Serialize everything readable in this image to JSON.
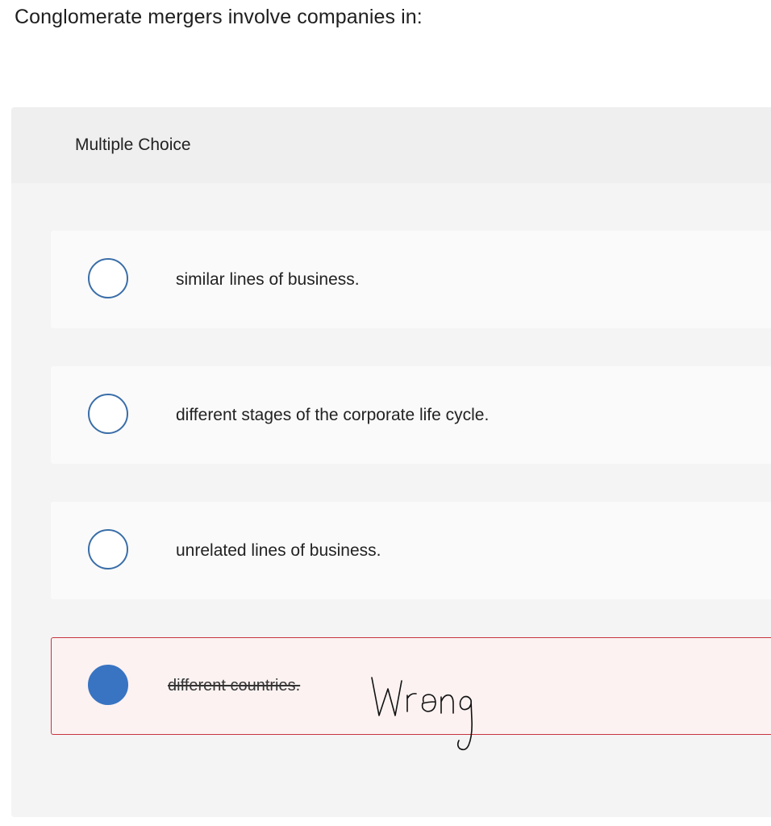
{
  "question": {
    "text": "Conglomerate mergers involve companies in:"
  },
  "panel": {
    "header_label": "Multiple Choice"
  },
  "options": [
    {
      "label": "similar lines of business.",
      "selected": false
    },
    {
      "label": "different stages of the corporate life cycle.",
      "selected": false
    },
    {
      "label": "unrelated lines of business.",
      "selected": false
    },
    {
      "label": "different countries.",
      "selected": true
    }
  ],
  "annotation": {
    "handwritten_text": "Wrong"
  },
  "colors": {
    "radio_border": "#3a6ea8",
    "radio_selected_fill": "#3874c2",
    "selected_border": "#c8343f",
    "selected_background": "#fcf2f2",
    "panel_background": "#f4f4f4",
    "option_background": "#fafafa"
  }
}
